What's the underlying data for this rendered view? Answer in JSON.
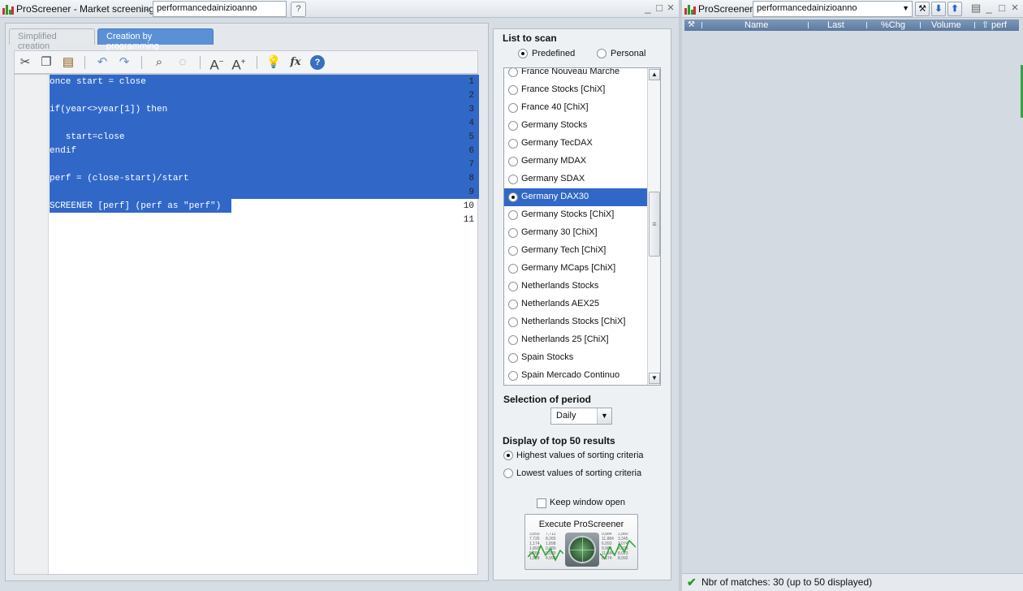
{
  "left_window": {
    "app_title": "ProScreener - Market screening",
    "title_separator": "-",
    "screener_name": "performancedainizioanno",
    "help_icon": "question-bubble-icon",
    "controls": {
      "minimize": "_",
      "maximize": "□",
      "close": "×"
    }
  },
  "tabs": [
    {
      "label": "Simplified creation",
      "active": false
    },
    {
      "label": "Creation by programming",
      "active": true
    }
  ],
  "toolbar": {
    "icons": [
      "cut-icon",
      "copy-icon",
      "paste-icon",
      "undo-icon",
      "redo-icon",
      "search-icon",
      "comment-icon",
      "decrease-font-icon",
      "increase-font-icon",
      "idea-bulb-icon",
      "function-icon",
      "help-icon"
    ],
    "font_decrease_glyph": "A",
    "font_increase_glyph": "A",
    "function_glyph": "fx",
    "help_glyph": "?"
  },
  "editor": {
    "lines": [
      {
        "num": "1",
        "text": "once start = close"
      },
      {
        "num": "2",
        "text": ""
      },
      {
        "num": "3",
        "text": "if(year<>year[1]) then"
      },
      {
        "num": "4",
        "text": ""
      },
      {
        "num": "5",
        "text": "   start=close"
      },
      {
        "num": "6",
        "text": "endif"
      },
      {
        "num": "7",
        "text": ""
      },
      {
        "num": "8",
        "text": "perf = (close-start)/start"
      },
      {
        "num": "9",
        "text": ""
      },
      {
        "num": "10",
        "text": "SCREENER [perf] (perf as \"perf\")"
      },
      {
        "num": "11",
        "text": ""
      }
    ]
  },
  "list_to_scan": {
    "title": "List to scan",
    "mode_options": [
      {
        "label": "Predefined",
        "selected": true
      },
      {
        "label": "Personal",
        "selected": false
      }
    ],
    "items": [
      {
        "label": "France Nouveau Marche",
        "selected": false
      },
      {
        "label": "France Stocks [ChiX]",
        "selected": false
      },
      {
        "label": "France 40 [ChiX]",
        "selected": false
      },
      {
        "label": "Germany Stocks",
        "selected": false
      },
      {
        "label": "Germany TecDAX",
        "selected": false
      },
      {
        "label": "Germany MDAX",
        "selected": false
      },
      {
        "label": "Germany SDAX",
        "selected": false
      },
      {
        "label": "Germany DAX30",
        "selected": true
      },
      {
        "label": "Germany Stocks [ChiX]",
        "selected": false
      },
      {
        "label": "Germany 30 [ChiX]",
        "selected": false
      },
      {
        "label": "Germany Tech [ChiX]",
        "selected": false
      },
      {
        "label": "Germany MCaps [ChiX]",
        "selected": false
      },
      {
        "label": "Netherlands Stocks",
        "selected": false
      },
      {
        "label": "Netherlands AEX25",
        "selected": false
      },
      {
        "label": "Netherlands Stocks [ChiX]",
        "selected": false
      },
      {
        "label": "Netherlands 25 [ChiX]",
        "selected": false
      },
      {
        "label": "Spain Stocks",
        "selected": false
      },
      {
        "label": "Spain Mercado Continuo",
        "selected": false
      }
    ],
    "scroll_up": "▲",
    "scroll_down": "▼",
    "thumb_grip": "≡"
  },
  "period": {
    "title": "Selection of period",
    "value": "Daily",
    "arrow": "▼"
  },
  "results_display": {
    "title": "Display of top 50 results",
    "options": [
      {
        "label": "Highest values of sorting criteria",
        "selected": true
      },
      {
        "label": "Lowest values of sorting criteria",
        "selected": false
      }
    ]
  },
  "keep_window_open": {
    "label": "Keep window open",
    "checked": false
  },
  "execute_button": {
    "label": "Execute ProScreener",
    "icon": "radar-icon",
    "ticker_left": [
      "3,893",
      "7,725",
      "1,174",
      "1,893",
      "5,289",
      "1,878",
      "7,712",
      "8,265",
      "1,898",
      "0,089",
      "9,089",
      "4,998"
    ],
    "ticker_right": [
      "9,884",
      "11,884",
      "6,093",
      "9,984",
      "11,884",
      "8,674",
      "1,880",
      "3,345",
      "2,074",
      "8,023",
      "8,023",
      "8,092"
    ]
  },
  "right_window": {
    "app_title": "ProScreener",
    "screener_name": "performancedainizioanno",
    "dropdown_arrow": "▼",
    "tool_icons": [
      "wrench-icon",
      "arrow-down-icon",
      "arrow-up-icon"
    ],
    "controls": {
      "menu": "▤",
      "minimize": "_",
      "maximize": "□",
      "close": "×"
    },
    "columns": [
      "Name",
      "Last",
      "%Chg",
      "Volume",
      "perf"
    ],
    "sort_column": "perf",
    "sort_arrow": "⇧",
    "header_icon": "wrench-icon",
    "status": "Nbr of matches: 30 (up to 50 displayed)",
    "status_icon": "check-icon"
  }
}
